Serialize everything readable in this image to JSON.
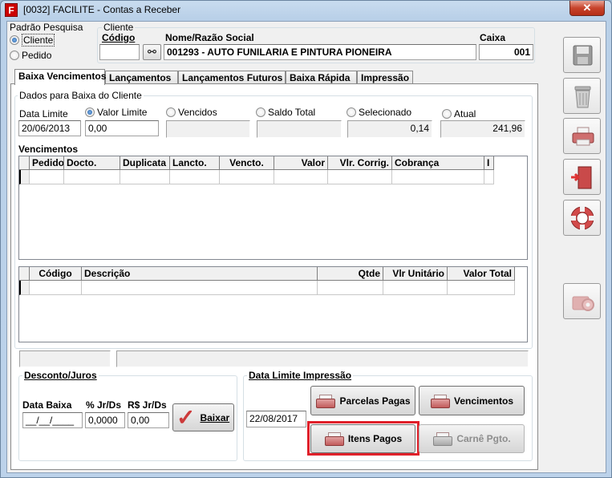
{
  "window": {
    "title": "[0032] FACILITE - Contas a Receber",
    "app_icon": "F",
    "close_glyph": "✕"
  },
  "search_mode": {
    "label": "Padrão Pesquisa",
    "options": [
      "Cliente",
      "Pedido"
    ],
    "selected": "Cliente"
  },
  "client": {
    "group_label": "Cliente",
    "code_label": "Código",
    "code_value": "",
    "name_label": "Nome/Razão Social",
    "name_value": "001293 - AUTO FUNILARIA E PINTURA PIONEIRA",
    "caixa_label": "Caixa",
    "caixa_value": "001"
  },
  "tabs": [
    "Baixa Vencimentos",
    "Lançamentos",
    "Lançamentos Futuros",
    "Baixa Rápida",
    "Impressão"
  ],
  "active_tab": "Baixa Vencimentos",
  "baixa": {
    "group_label": "Dados para Baixa do Cliente",
    "data_limite_label": "Data Limite",
    "data_limite_value": "20/06/2013",
    "options": [
      {
        "label": "Valor Limite",
        "value": "0,00",
        "selected": true
      },
      {
        "label": "Vencidos",
        "value": "",
        "selected": false
      },
      {
        "label": "Saldo Total",
        "value": "",
        "selected": false
      },
      {
        "label": "Selecionado",
        "value": "0,14",
        "selected": false
      },
      {
        "label": "Atual",
        "value": "241,96",
        "selected": false
      }
    ]
  },
  "vencimentos": {
    "label": "Vencimentos",
    "columns": [
      "Pedido",
      "Docto.",
      "Duplicata",
      "Lancto.",
      "Vencto.",
      "Valor",
      "Vlr. Corrig.",
      "Cobrança",
      "I"
    ]
  },
  "itens": {
    "columns": [
      "Código",
      "Descrição",
      "Qtde",
      "Vlr Unitário",
      "Valor Total"
    ]
  },
  "desconto": {
    "group_label": "Desconto/Juros",
    "data_baixa_label": "Data Baixa",
    "data_baixa_value": "__/__/____",
    "pct_label": "% Jr/Ds",
    "pct_value": "0,0000",
    "rs_label": "R$ Jr/Ds",
    "rs_value": "0,00",
    "baixar_label": "Baixar"
  },
  "impressao": {
    "group_label": "Data Limite Impressão",
    "date_value": "22/08/2017",
    "buttons": {
      "parcelas_pagas": "Parcelas Pagas",
      "vencimentos": "Vencimentos",
      "itens_pagos": "Itens Pagos",
      "carne_pgto": "Carnê Pgto."
    }
  },
  "sidebar": [
    "save-icon",
    "trash-icon",
    "printer-icon",
    "exit-door-icon",
    "lifebuoy-icon",
    "settings-icon"
  ],
  "colors": {
    "highlight": "#e0202a",
    "accent_red": "#c25c5c"
  }
}
